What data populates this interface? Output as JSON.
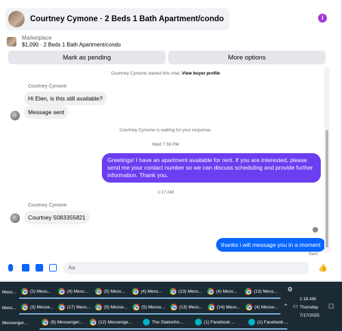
{
  "header": {
    "title": "Courtney Cymone · 2 Beds 1 Bath Apartment/condo",
    "info": "i"
  },
  "listing": {
    "label": "Marketplace",
    "detail": "$1,090 · 2 Beds 1 Bath Apartment/condo"
  },
  "actions": {
    "pending": "Mark as pending",
    "more": "More options"
  },
  "chat": {
    "started": "Courtney Cymone started this chat.",
    "view_profile": "View buyer profile",
    "sender1": "Courtney Cymone",
    "msg1": "Hi Elen, is this still available?",
    "msg2": "Message sent",
    "waiting": "Courtney Cymone is waiting for your response.",
    "time1": "Wed 7:38 PM",
    "out1": "Greetings! I have an apartment available for rent. If you are interested, please send me your contact number so we can discuss scheduling and provide further information. Thank you.",
    "time2": "1:17 AM",
    "sender2": "Courtney Cymone",
    "msg3": "Courtney 5083355821",
    "out2": "thanks i will message you in a moment",
    "status": "Sent"
  },
  "composer": {
    "placeholder": "Aa"
  },
  "taskbar": {
    "row1": [
      "Mess...",
      "(2) Mess...",
      "(4) Mess...",
      "(5) Mess...",
      "(4) Mess...",
      "(13) Mess...",
      "(4) Mess...",
      "(13) Mess..."
    ],
    "row2": [
      "Mess...",
      "(3) Messe...",
      "(17) Mess...",
      "(5) Messe...",
      "(5) Messe...",
      "(13) Mess...",
      "(14) Mess...",
      "(4) Messe..."
    ],
    "row3": [
      "Messenger...",
      "(6) Messenger...",
      "(12) Messenge...",
      "The Stationho...",
      "(1) Facebook ...",
      "(1) Facebook ..."
    ],
    "time": "1:18 AM",
    "day": "Thursday",
    "date": "7/17/2025"
  }
}
